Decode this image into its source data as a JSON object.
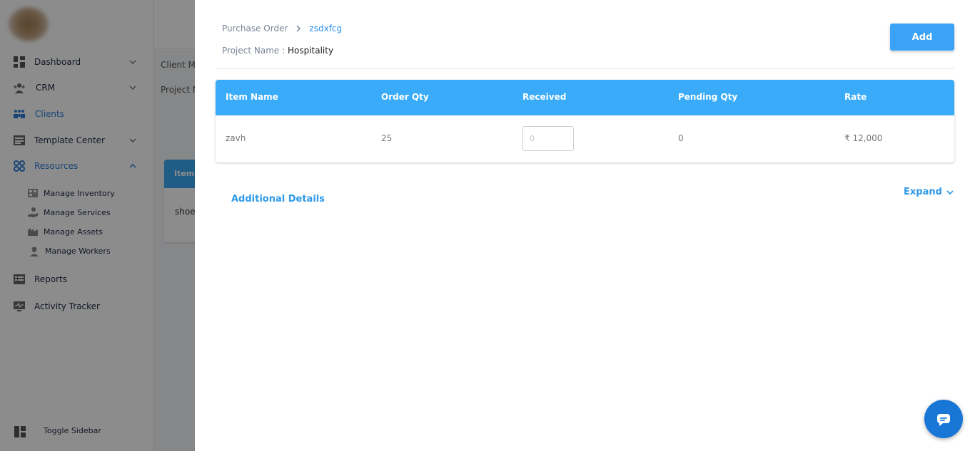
{
  "sidebar": {
    "items": [
      {
        "label": "Dashboard",
        "icon": "dashboard-icon"
      },
      {
        "label": "CRM",
        "icon": "crm-icon"
      },
      {
        "label": "Clients",
        "icon": "clients-icon"
      },
      {
        "label": "Template Center",
        "icon": "template-icon"
      },
      {
        "label": "Resources",
        "icon": "resources-icon"
      }
    ],
    "sub_items": [
      {
        "label": "Manage Inventory",
        "icon": "inventory-icon"
      },
      {
        "label": "Manage Services",
        "icon": "services-icon"
      },
      {
        "label": "Manage Assets",
        "icon": "assets-icon"
      },
      {
        "label": "Manage Workers",
        "icon": "workers-icon"
      }
    ],
    "bottom_items": [
      {
        "label": "Reports",
        "icon": "reports-icon"
      },
      {
        "label": "Activity Tracker",
        "icon": "activity-icon"
      }
    ],
    "toggle_label": "Toggle Sidebar"
  },
  "background": {
    "breadcrumb_partial": "Client M",
    "project_partial": "Project N",
    "card_header_partial": "Item",
    "card_row_partial": "shoe"
  },
  "drawer": {
    "breadcrumb": {
      "root": "Purchase Order",
      "current": "zsdxfcg"
    },
    "project_label": "Project Name : ",
    "project_value": "Hospitality",
    "add_label": "Add",
    "table": {
      "columns": [
        "Item Name",
        "Order Qty",
        "Received",
        "Pending Qty",
        "Rate"
      ],
      "rows": [
        {
          "item_name": "zavh",
          "order_qty": "25",
          "received_placeholder": "0",
          "pending_qty": "0",
          "rate": "₹ 12,000"
        }
      ]
    },
    "additional_details_label": "Additional Details",
    "expand_label": "Expand"
  },
  "colors": {
    "accent": "#3aabf8",
    "link": "#2f9ae8",
    "fab": "#1877d6"
  }
}
